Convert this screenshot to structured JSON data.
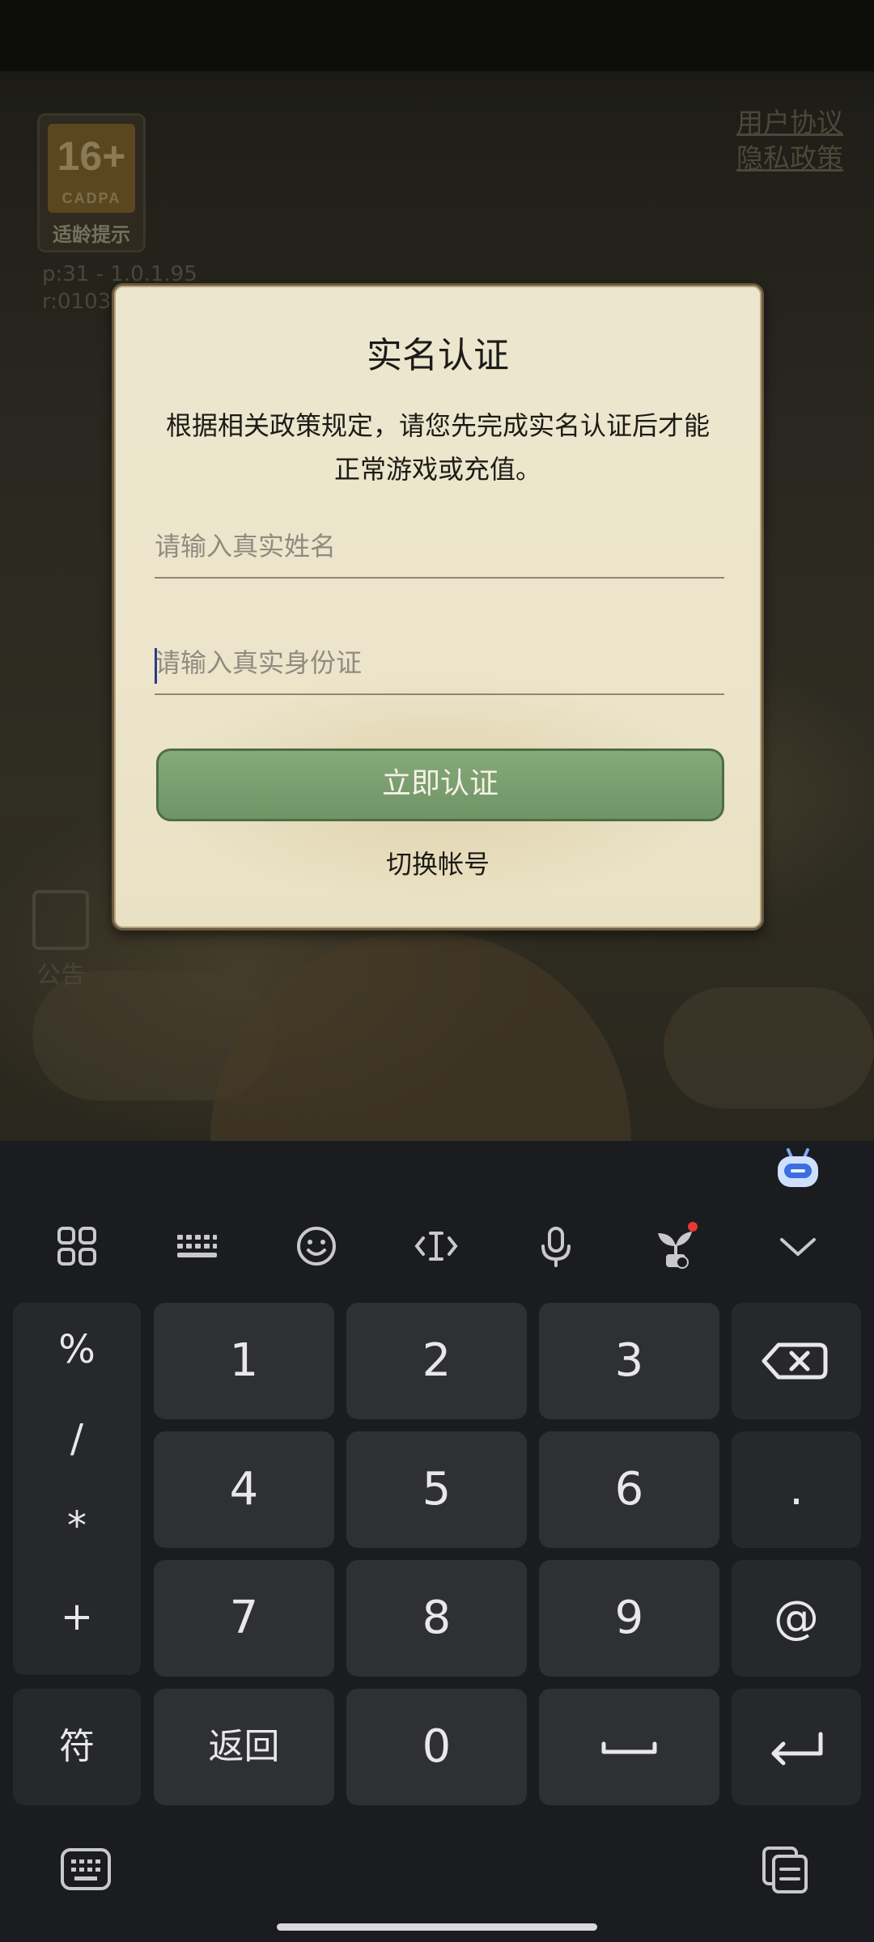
{
  "game": {
    "rating": "16+",
    "rating_org": "CADPA",
    "rating_tip": "适龄提示",
    "version_line1": "p:31 - 1.0.1.95",
    "version_line2": "r:0103",
    "user_agreement": "用户协议",
    "privacy_policy": "隐私政策",
    "notice_label": "公告"
  },
  "dialog": {
    "title": "实名认证",
    "description": "根据相关政策规定，请您先完成实名认证后才能正常游戏或充值。",
    "name_placeholder": "请输入真实姓名",
    "id_placeholder": "请输入真实身份证",
    "confirm_label": "立即认证",
    "switch_account_label": "切换帐号"
  },
  "keyboard": {
    "toolbar_icons": [
      "apps-grid-icon",
      "keyboard-layout-icon",
      "emoji-icon",
      "text-cursor-icon",
      "microphone-icon",
      "plant-icon",
      "chevron-down-icon"
    ],
    "symbols": [
      "%",
      "/",
      "*",
      "+"
    ],
    "digits": [
      "1",
      "2",
      "3",
      "4",
      "5",
      "6",
      "7",
      "8",
      "9"
    ],
    "zero": "0",
    "dot": ".",
    "at": "@",
    "symbols_key": "符",
    "back_key": "返回",
    "accent_color": "#6f9465",
    "notification_dot_color": "#e53935"
  }
}
